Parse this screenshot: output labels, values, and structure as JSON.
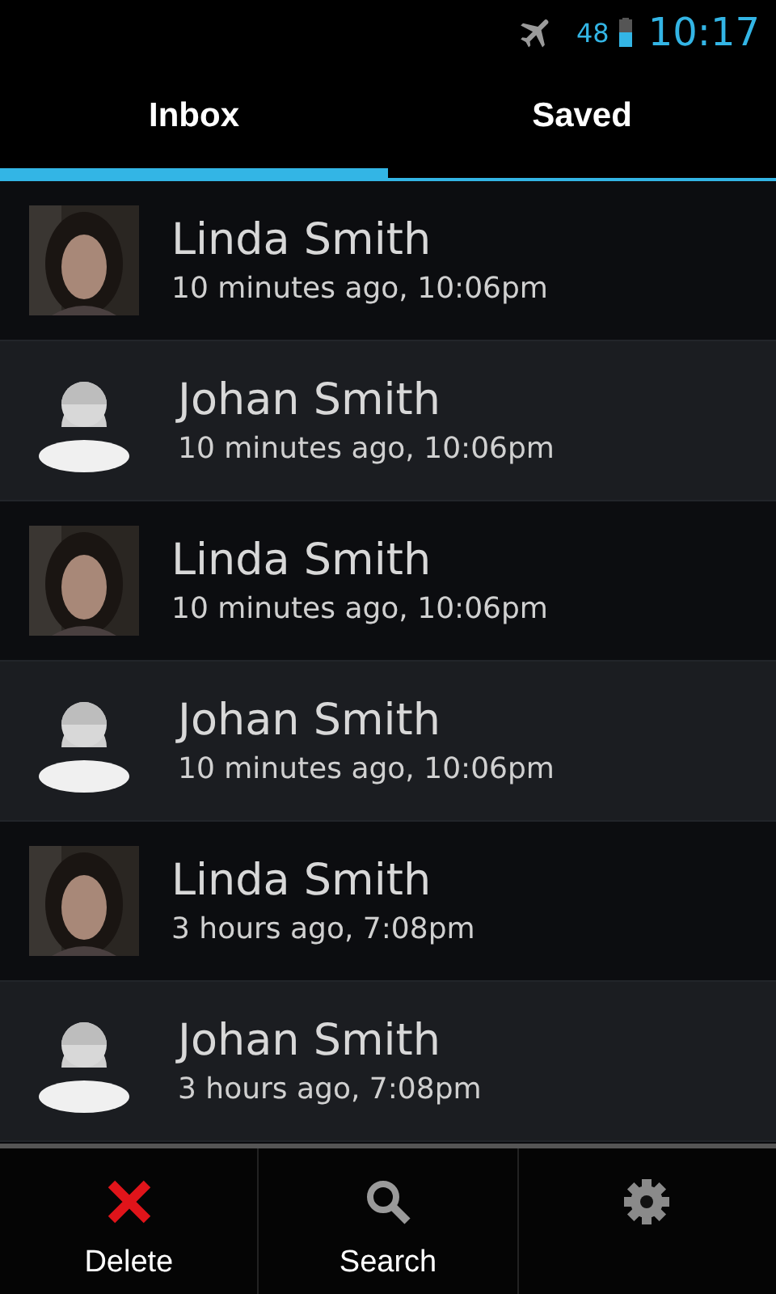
{
  "status_bar": {
    "battery": "48",
    "time": "10:17",
    "airplane_mode": true
  },
  "tabs": [
    {
      "label": "Inbox",
      "selected": true
    },
    {
      "label": "Saved",
      "selected": false
    }
  ],
  "messages": [
    {
      "name": "Linda Smith",
      "time": "10 minutes ago, 10:06pm"
    },
    {
      "name": "Johan Smith",
      "time": "10 minutes ago, 10:06pm",
      "kind": "default"
    },
    {
      "name": "Linda Smith",
      "time": "10 minutes ago, 10:06pm"
    },
    {
      "name": "Johan Smith",
      "time": "10 minutes ago, 10:06pm",
      "kind": "default"
    },
    {
      "name": "Linda Smith",
      "time": "3 hours ago, 7:08pm"
    },
    {
      "name": "Johan Smith",
      "time": "3 hours ago, 7:08pm",
      "kind": "default"
    }
  ],
  "actions": [
    {
      "kind": "delete",
      "label": "Delete"
    },
    {
      "kind": "search",
      "label": "Search"
    },
    {
      "kind": "settings"
    }
  ]
}
